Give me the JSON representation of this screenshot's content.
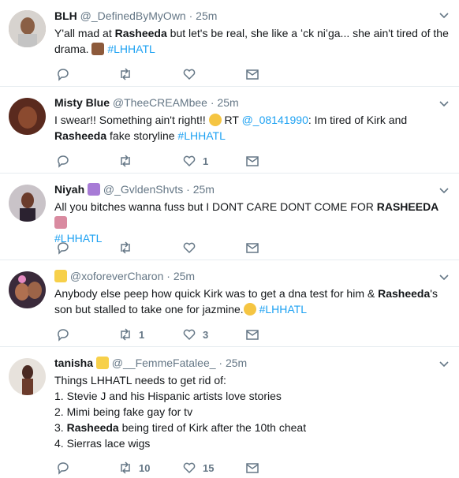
{
  "tweets": [
    {
      "name": "BLH",
      "handle": "@_DefinedByMyOwn",
      "time": "25m",
      "text_before": "Y'all mad at ",
      "bold": "Rasheeda",
      "text_after": " but let's be real, she like a ʻck niʻga... she ain't tired of the drama. ",
      "hashtag": "#LHHATL",
      "reply_count": "",
      "retweet_count": "",
      "like_count": ""
    },
    {
      "name": "Misty Blue",
      "handle": "@TheeCREAMbee",
      "time": "25m",
      "text_before": "I swear!! Something ain't right!! ",
      "rt": "RT ",
      "mention": "@_08141990",
      "text_mid": ": Im tired of Kirk and ",
      "bold": "Rasheeda",
      "text_after": " fake storyline ",
      "hashtag": "#LHHATL",
      "like_count": "1"
    },
    {
      "name": "Niyah",
      "handle": "@_GvldenShvts",
      "time": "25m",
      "text_before": "All you bitches wanna fuss but I DONT CARE DONT COME FOR ",
      "bold": "RASHEEDA",
      "hashtag": "#LHHATL"
    },
    {
      "name": "",
      "handle": "@xoforeverCharon",
      "time": "25m",
      "text_before": "Anybody else peep how quick Kirk was to get a dna test for him & ",
      "bold": "Rasheeda",
      "text_after": "'s son but stalled to take one for jazmine.",
      "hashtag": "#LHHATL",
      "retweet_count": "1",
      "like_count": "3"
    },
    {
      "name": "tanisha",
      "handle": "@__FemmeFatalee_",
      "time": "25m",
      "lines": [
        "Things LHHATL needs to get rid of:",
        "1. Stevie J and his Hispanic artists love stories",
        "2. Mimi being fake gay for tv",
        "4. Sierras lace wigs"
      ],
      "line3_prefix": "3. ",
      "line3_bold": "Rasheeda",
      "line3_after": " being tired of Kirk after the 10th cheat",
      "retweet_count": "10",
      "like_count": "15"
    }
  ],
  "separator": "·",
  "colors": {
    "link": "#1da1f2",
    "muted": "#657786",
    "divider": "#e6ecf0"
  }
}
